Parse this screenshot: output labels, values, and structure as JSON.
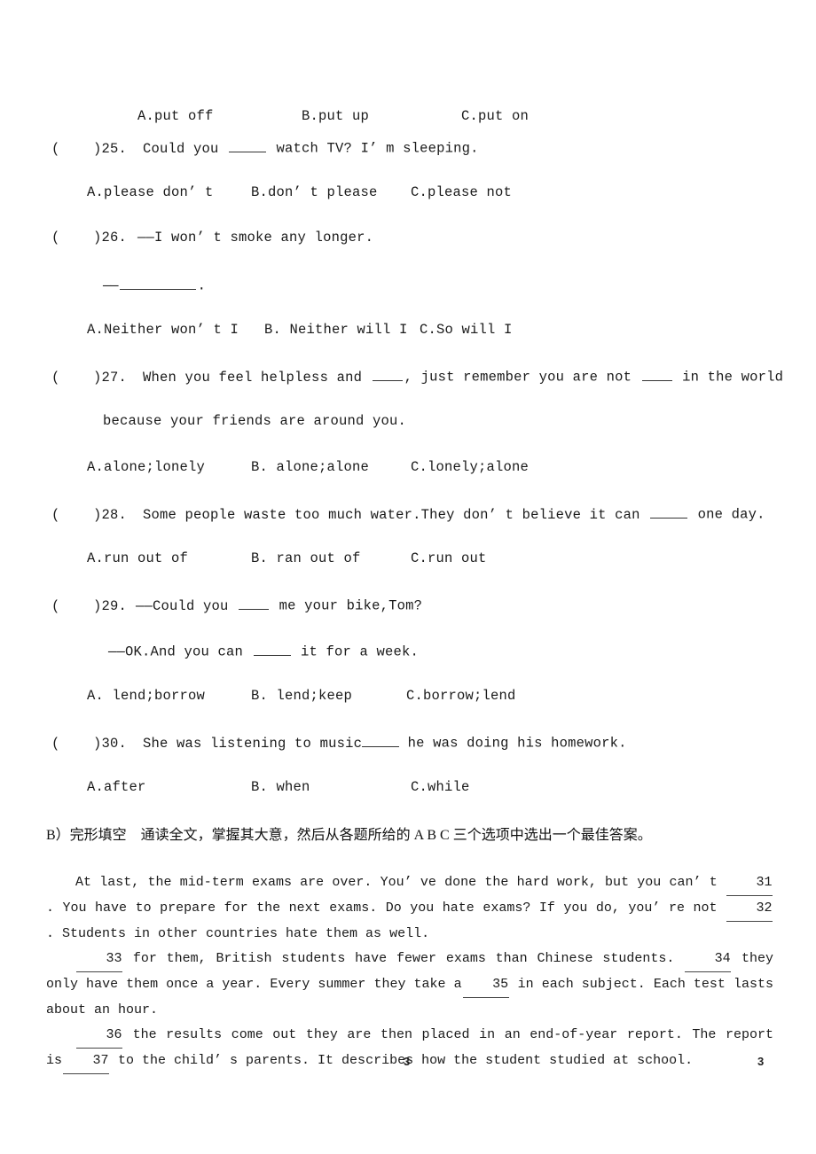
{
  "document": {
    "type": "exam-paper",
    "page_number_center": "3",
    "page_number_right": "3"
  },
  "multiple_choice": {
    "orphan_options_row": {
      "a": "A.put off",
      "b": "B.put up",
      "c": "C.put on"
    },
    "questions": [
      {
        "marker_open": "(",
        "marker_close": ")",
        "number": "25.",
        "stem_part1": "Could you ",
        "stem_part2": " watch TV? I’ m sleeping.",
        "options": {
          "a": "A.please don’ t",
          "b": "B.don’ t please",
          "c": "C.please not"
        }
      },
      {
        "marker_open": "(",
        "marker_close": ")",
        "number": "26.",
        "stem_part1": "——I won’ t smoke any longer.",
        "continuation_dash": "——",
        "continuation_tail": ".",
        "options": {
          "a": "A.Neither won’ t I",
          "b": "B. Neither will I",
          "c": "C.So will I"
        }
      },
      {
        "marker_open": "(",
        "marker_close": ")",
        "number": "27.",
        "stem_part1": "When you feel helpless and ",
        "stem_part2": ", just remember you are not ",
        "stem_part3": " in the world",
        "continuation": "because your friends are around you.",
        "options": {
          "a": "A.alone;lonely",
          "b": "B. alone;alone",
          "c": "C.lonely;alone"
        }
      },
      {
        "marker_open": "(",
        "marker_close": ")",
        "number": "28.",
        "stem_part1": "Some people waste too much water.They don’ t believe it can ",
        "stem_part2": " one day.",
        "options": {
          "a": "A.run out of",
          "b": "B. ran out of",
          "c": "C.run out"
        }
      },
      {
        "marker_open": "(",
        "marker_close": ")",
        "number": "29.",
        "stem_part1": "——Could you ",
        "stem_part2": " me your bike,Tom?",
        "continuation_part1": "——OK.And you can ",
        "continuation_part2": " it for a week.",
        "options": {
          "a": "A. lend;borrow",
          "b": "B. lend;keep",
          "c": "C.borrow;lend"
        }
      },
      {
        "marker_open": "(",
        "marker_close": ")",
        "number": "30.",
        "stem_part1": "She was listening to music",
        "stem_part2": " he was doing his homework.",
        "options": {
          "a": "A.after",
          "b": "B. when",
          "c": "C.while"
        }
      }
    ]
  },
  "section_b": {
    "heading": "B）完形填空　通读全文，掌握其大意，然后从各题所给的 A B C 三个选项中选出一个最佳答案。"
  },
  "cloze_passage": {
    "p1_a": "At last, the mid-term exams are over. You’ ve done the hard work, but you can’ t ",
    "p1_blank1": "31",
    "p1_b": ". You have to prepare for the next exams. Do you hate exams? If you do, you’ re not ",
    "p1_blank2": "32",
    "p1_c": " . Students in other countries hate them as well.",
    "p2_blank3": "33",
    "p2_a": " for them, British students have fewer exams than Chinese students. ",
    "p2_blank4": "34",
    "p2_b": " they only have them once a year. Every summer they take a",
    "p2_blank5": "35",
    "p2_c": " in each subject. Each test lasts about an hour.",
    "p3_blank6": "36",
    "p3_a": " the results come out they are then placed in an end-of-year report. The report is",
    "p3_blank7": "37",
    "p3_b": " to the child’ s parents. It describes how the student studied at school."
  }
}
